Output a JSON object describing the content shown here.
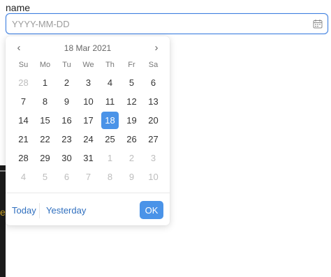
{
  "field": {
    "label": "name",
    "placeholder": "YYYY-MM-DD",
    "value": ""
  },
  "calendar": {
    "title": "18 Mar 2021",
    "prev_icon": "chevron-left-icon",
    "next_icon": "chevron-right-icon",
    "weekdays": [
      "Su",
      "Mo",
      "Tu",
      "We",
      "Th",
      "Fr",
      "Sa"
    ],
    "selected_day": "18",
    "weeks": [
      [
        {
          "d": "28",
          "m": true
        },
        {
          "d": "1"
        },
        {
          "d": "2"
        },
        {
          "d": "3"
        },
        {
          "d": "4"
        },
        {
          "d": "5"
        },
        {
          "d": "6"
        }
      ],
      [
        {
          "d": "7"
        },
        {
          "d": "8"
        },
        {
          "d": "9"
        },
        {
          "d": "10"
        },
        {
          "d": "11"
        },
        {
          "d": "12"
        },
        {
          "d": "13"
        }
      ],
      [
        {
          "d": "14"
        },
        {
          "d": "15"
        },
        {
          "d": "16"
        },
        {
          "d": "17"
        },
        {
          "d": "18",
          "s": true
        },
        {
          "d": "19"
        },
        {
          "d": "20"
        }
      ],
      [
        {
          "d": "21"
        },
        {
          "d": "22"
        },
        {
          "d": "23"
        },
        {
          "d": "24"
        },
        {
          "d": "25"
        },
        {
          "d": "26"
        },
        {
          "d": "27"
        }
      ],
      [
        {
          "d": "28"
        },
        {
          "d": "29"
        },
        {
          "d": "30"
        },
        {
          "d": "31"
        },
        {
          "d": "1",
          "m": true
        },
        {
          "d": "2",
          "m": true
        },
        {
          "d": "3",
          "m": true
        }
      ],
      [
        {
          "d": "4",
          "m": true
        },
        {
          "d": "5",
          "m": true
        },
        {
          "d": "6",
          "m": true
        },
        {
          "d": "7",
          "m": true
        },
        {
          "d": "8",
          "m": true
        },
        {
          "d": "9",
          "m": true
        },
        {
          "d": "10",
          "m": true
        }
      ]
    ]
  },
  "footer": {
    "today": "Today",
    "yesterday": "Yesterday",
    "ok": "OK"
  },
  "colors": {
    "accent": "#4a93e8",
    "link": "#2f6fbf",
    "muted_day": "#bdbdbd"
  }
}
